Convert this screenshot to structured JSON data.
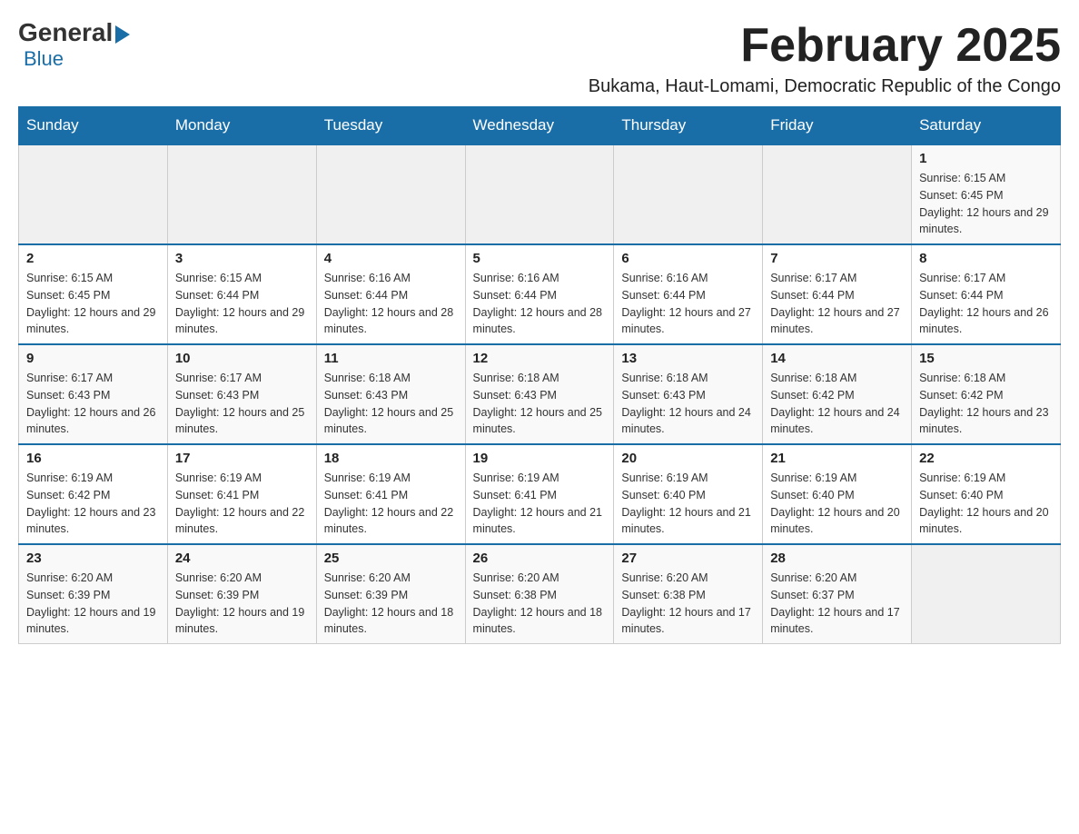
{
  "logo": {
    "text_general": "General",
    "text_blue": "Blue"
  },
  "header": {
    "month_year": "February 2025",
    "location": "Bukama, Haut-Lomami, Democratic Republic of the Congo"
  },
  "weekdays": [
    "Sunday",
    "Monday",
    "Tuesday",
    "Wednesday",
    "Thursday",
    "Friday",
    "Saturday"
  ],
  "weeks": [
    [
      {
        "day": "",
        "sunrise": "",
        "sunset": "",
        "daylight": ""
      },
      {
        "day": "",
        "sunrise": "",
        "sunset": "",
        "daylight": ""
      },
      {
        "day": "",
        "sunrise": "",
        "sunset": "",
        "daylight": ""
      },
      {
        "day": "",
        "sunrise": "",
        "sunset": "",
        "daylight": ""
      },
      {
        "day": "",
        "sunrise": "",
        "sunset": "",
        "daylight": ""
      },
      {
        "day": "",
        "sunrise": "",
        "sunset": "",
        "daylight": ""
      },
      {
        "day": "1",
        "sunrise": "Sunrise: 6:15 AM",
        "sunset": "Sunset: 6:45 PM",
        "daylight": "Daylight: 12 hours and 29 minutes."
      }
    ],
    [
      {
        "day": "2",
        "sunrise": "Sunrise: 6:15 AM",
        "sunset": "Sunset: 6:45 PM",
        "daylight": "Daylight: 12 hours and 29 minutes."
      },
      {
        "day": "3",
        "sunrise": "Sunrise: 6:15 AM",
        "sunset": "Sunset: 6:44 PM",
        "daylight": "Daylight: 12 hours and 29 minutes."
      },
      {
        "day": "4",
        "sunrise": "Sunrise: 6:16 AM",
        "sunset": "Sunset: 6:44 PM",
        "daylight": "Daylight: 12 hours and 28 minutes."
      },
      {
        "day": "5",
        "sunrise": "Sunrise: 6:16 AM",
        "sunset": "Sunset: 6:44 PM",
        "daylight": "Daylight: 12 hours and 28 minutes."
      },
      {
        "day": "6",
        "sunrise": "Sunrise: 6:16 AM",
        "sunset": "Sunset: 6:44 PM",
        "daylight": "Daylight: 12 hours and 27 minutes."
      },
      {
        "day": "7",
        "sunrise": "Sunrise: 6:17 AM",
        "sunset": "Sunset: 6:44 PM",
        "daylight": "Daylight: 12 hours and 27 minutes."
      },
      {
        "day": "8",
        "sunrise": "Sunrise: 6:17 AM",
        "sunset": "Sunset: 6:44 PM",
        "daylight": "Daylight: 12 hours and 26 minutes."
      }
    ],
    [
      {
        "day": "9",
        "sunrise": "Sunrise: 6:17 AM",
        "sunset": "Sunset: 6:43 PM",
        "daylight": "Daylight: 12 hours and 26 minutes."
      },
      {
        "day": "10",
        "sunrise": "Sunrise: 6:17 AM",
        "sunset": "Sunset: 6:43 PM",
        "daylight": "Daylight: 12 hours and 25 minutes."
      },
      {
        "day": "11",
        "sunrise": "Sunrise: 6:18 AM",
        "sunset": "Sunset: 6:43 PM",
        "daylight": "Daylight: 12 hours and 25 minutes."
      },
      {
        "day": "12",
        "sunrise": "Sunrise: 6:18 AM",
        "sunset": "Sunset: 6:43 PM",
        "daylight": "Daylight: 12 hours and 25 minutes."
      },
      {
        "day": "13",
        "sunrise": "Sunrise: 6:18 AM",
        "sunset": "Sunset: 6:43 PM",
        "daylight": "Daylight: 12 hours and 24 minutes."
      },
      {
        "day": "14",
        "sunrise": "Sunrise: 6:18 AM",
        "sunset": "Sunset: 6:42 PM",
        "daylight": "Daylight: 12 hours and 24 minutes."
      },
      {
        "day": "15",
        "sunrise": "Sunrise: 6:18 AM",
        "sunset": "Sunset: 6:42 PM",
        "daylight": "Daylight: 12 hours and 23 minutes."
      }
    ],
    [
      {
        "day": "16",
        "sunrise": "Sunrise: 6:19 AM",
        "sunset": "Sunset: 6:42 PM",
        "daylight": "Daylight: 12 hours and 23 minutes."
      },
      {
        "day": "17",
        "sunrise": "Sunrise: 6:19 AM",
        "sunset": "Sunset: 6:41 PM",
        "daylight": "Daylight: 12 hours and 22 minutes."
      },
      {
        "day": "18",
        "sunrise": "Sunrise: 6:19 AM",
        "sunset": "Sunset: 6:41 PM",
        "daylight": "Daylight: 12 hours and 22 minutes."
      },
      {
        "day": "19",
        "sunrise": "Sunrise: 6:19 AM",
        "sunset": "Sunset: 6:41 PM",
        "daylight": "Daylight: 12 hours and 21 minutes."
      },
      {
        "day": "20",
        "sunrise": "Sunrise: 6:19 AM",
        "sunset": "Sunset: 6:40 PM",
        "daylight": "Daylight: 12 hours and 21 minutes."
      },
      {
        "day": "21",
        "sunrise": "Sunrise: 6:19 AM",
        "sunset": "Sunset: 6:40 PM",
        "daylight": "Daylight: 12 hours and 20 minutes."
      },
      {
        "day": "22",
        "sunrise": "Sunrise: 6:19 AM",
        "sunset": "Sunset: 6:40 PM",
        "daylight": "Daylight: 12 hours and 20 minutes."
      }
    ],
    [
      {
        "day": "23",
        "sunrise": "Sunrise: 6:20 AM",
        "sunset": "Sunset: 6:39 PM",
        "daylight": "Daylight: 12 hours and 19 minutes."
      },
      {
        "day": "24",
        "sunrise": "Sunrise: 6:20 AM",
        "sunset": "Sunset: 6:39 PM",
        "daylight": "Daylight: 12 hours and 19 minutes."
      },
      {
        "day": "25",
        "sunrise": "Sunrise: 6:20 AM",
        "sunset": "Sunset: 6:39 PM",
        "daylight": "Daylight: 12 hours and 18 minutes."
      },
      {
        "day": "26",
        "sunrise": "Sunrise: 6:20 AM",
        "sunset": "Sunset: 6:38 PM",
        "daylight": "Daylight: 12 hours and 18 minutes."
      },
      {
        "day": "27",
        "sunrise": "Sunrise: 6:20 AM",
        "sunset": "Sunset: 6:38 PM",
        "daylight": "Daylight: 12 hours and 17 minutes."
      },
      {
        "day": "28",
        "sunrise": "Sunrise: 6:20 AM",
        "sunset": "Sunset: 6:37 PM",
        "daylight": "Daylight: 12 hours and 17 minutes."
      },
      {
        "day": "",
        "sunrise": "",
        "sunset": "",
        "daylight": ""
      }
    ]
  ]
}
